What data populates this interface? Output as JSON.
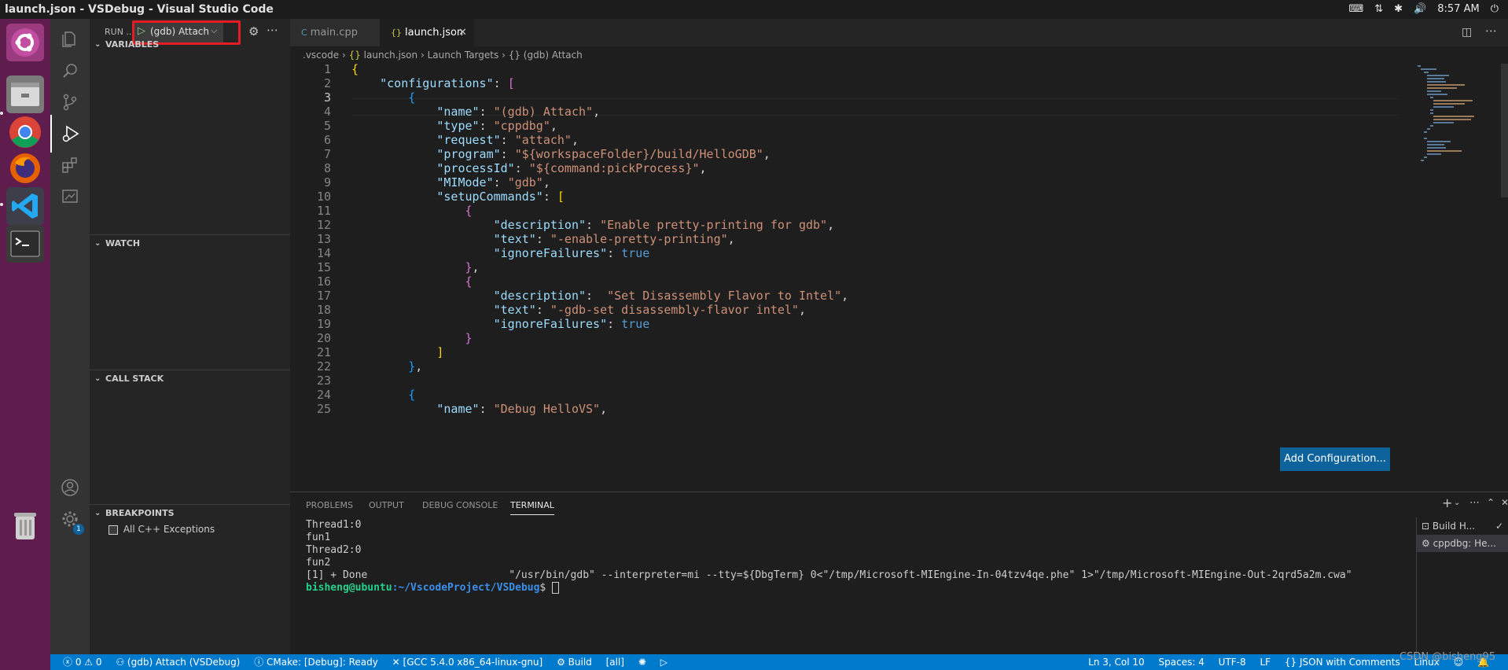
{
  "window_title": "launch.json - VSDebug - Visual Studio Code",
  "tray": {
    "time": "8:57 AM"
  },
  "dock": [
    "ubuntu-logo-icon",
    "files-icon",
    "chrome-icon",
    "firefox-icon",
    "vscode-icon",
    "terminal-icon",
    "trash-icon"
  ],
  "sidebar": {
    "run_label": "RUN ...",
    "config_selected": "(gdb) Attach",
    "sections": {
      "variables": "VARIABLES",
      "watch": "WATCH",
      "call_stack": "CALL STACK",
      "breakpoints": "BREAKPOINTS"
    },
    "breakpoint_item": "All C++ Exceptions"
  },
  "tabs": [
    {
      "label": "main.cpp",
      "active": false
    },
    {
      "label": "launch.json",
      "active": true
    }
  ],
  "breadcrumb": [
    ".vscode",
    "launch.json",
    "Launch Targets",
    "(gdb) Attach"
  ],
  "editor": {
    "current_line": 3,
    "add_config_button": "Add Configuration..."
  },
  "panel": {
    "tabs": [
      "PROBLEMS",
      "OUTPUT",
      "DEBUG CONSOLE",
      "TERMINAL"
    ],
    "active_tab": "TERMINAL",
    "terminal_lines": [
      "Thread1:0",
      "fun1",
      "Thread2:0",
      "fun2",
      "[1] + Done                       \"/usr/bin/gdb\" --interpreter=mi --tty=${DbgTerm} 0<\"/tmp/Microsoft-MIEngine-In-04tzv4qe.phe\" 1>\"/tmp/Microsoft-MIEngine-Out-2qrd5a2m.cwa\""
    ],
    "prompt_user": "bisheng@ubuntu",
    "prompt_path": ":~/VscodeProject/VSDebug",
    "prompt_symbol": "$ ",
    "terminal_list": [
      "Build H...",
      "cppdbg: He..."
    ]
  },
  "status": {
    "errors": "0",
    "warnings": "0",
    "debug": "(gdb) Attach (VSDebug)",
    "cmake": "CMake: [Debug]: Ready",
    "kit": "[GCC 5.4.0 x86_64-linux-gnu]",
    "build": "Build",
    "target": "[all]",
    "position": "Ln 3, Col 10",
    "spaces": "Spaces: 4",
    "encoding": "UTF-8",
    "eol": "LF",
    "language": "JSON with Comments",
    "platform": "Linux"
  },
  "watermark": "CSDN @bisheng95"
}
